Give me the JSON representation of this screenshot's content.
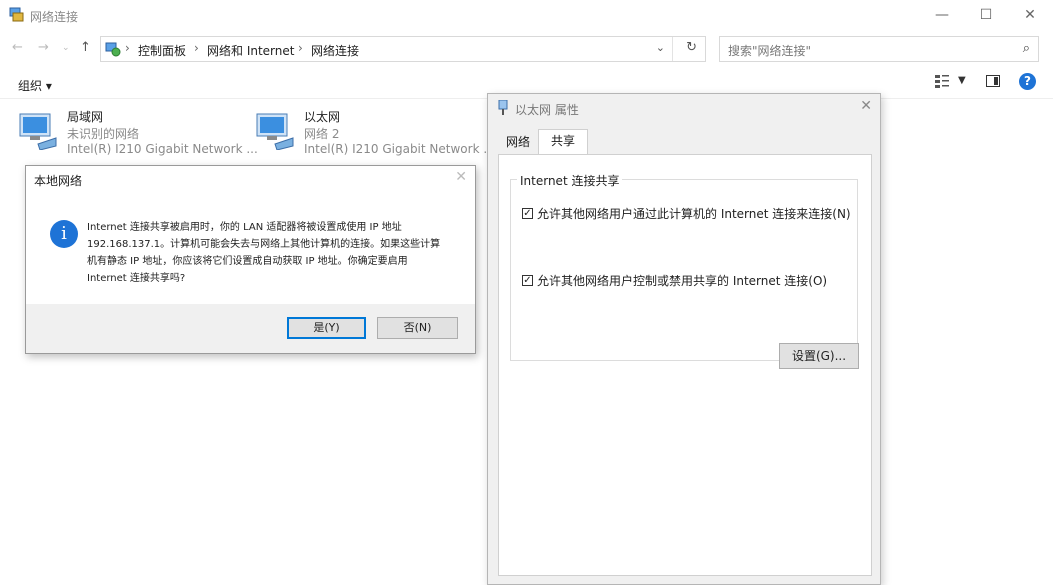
{
  "window": {
    "title": "网络连接"
  },
  "address": {
    "crumbs": [
      "控制面板",
      "网络和 Internet",
      "网络连接"
    ],
    "search_placeholder": "搜索\"网络连接\""
  },
  "toolbar": {
    "organize": "组织 ▾"
  },
  "connections": [
    {
      "name": "局域网",
      "status": "未识别的网络",
      "adapter": "Intel(R) I210 Gigabit Network ..."
    },
    {
      "name": "以太网",
      "status": "网络 2",
      "adapter": "Intel(R) I210 Gigabit Network ..."
    }
  ],
  "msgbox": {
    "title": "本地网络",
    "lines": [
      "Internet 连接共享被启用时，你的 LAN 适配器将被设置成使用 IP 地址",
      "192.168.137.1。计算机可能会失去与网络上其他计算机的连接。如果这些计算",
      "机有静态 IP 地址，你应该将它们设置成自动获取 IP 地址。你确定要启用",
      "Internet 连接共享吗?"
    ],
    "yes": "是(Y)",
    "no": "否(N)"
  },
  "props": {
    "title": "以太网 属性",
    "tabs": [
      "网络",
      "共享"
    ],
    "group_title": "Internet 连接共享",
    "options": [
      {
        "label": "允许其他网络用户通过此计算机的 Internet 连接来连接(N)",
        "checked": true
      },
      {
        "label": "允许其他网络用户控制或禁用共享的 Internet 连接(O)",
        "checked": true
      }
    ],
    "settings_button": "设置(G)..."
  },
  "colors": {
    "accent": "#0078d7",
    "info": "#1e73d6"
  }
}
